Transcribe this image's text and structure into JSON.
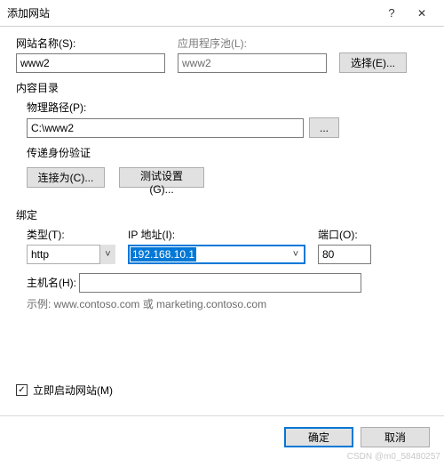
{
  "titlebar": {
    "title": "添加网站"
  },
  "siteName": {
    "label": "网站名称(S):",
    "value": "www2"
  },
  "appPool": {
    "label": "应用程序池(L):",
    "value": "www2",
    "selectBtn": "选择(E)..."
  },
  "contentDir": {
    "title": "内容目录"
  },
  "physPath": {
    "label": "物理路径(P):",
    "value": "C:\\www2",
    "browseBtn": "..."
  },
  "passAuth": {
    "title": "传递身份验证",
    "connectAs": "连接为(C)...",
    "testSettings": "测试设置(G)..."
  },
  "binding": {
    "title": "绑定",
    "typeLabel": "类型(T):",
    "typeValue": "http",
    "ipLabel": "IP 地址(I):",
    "ipValue": "192.168.10.1",
    "portLabel": "端口(O):",
    "portValue": "80",
    "hostLabel": "主机名(H):",
    "hostValue": "",
    "example": "示例: www.contoso.com 或 marketing.contoso.com"
  },
  "startNow": {
    "label": "立即启动网站(M)"
  },
  "footer": {
    "ok": "确定",
    "cancel": "取消"
  },
  "watermark": "CSDN @m0_58480257"
}
